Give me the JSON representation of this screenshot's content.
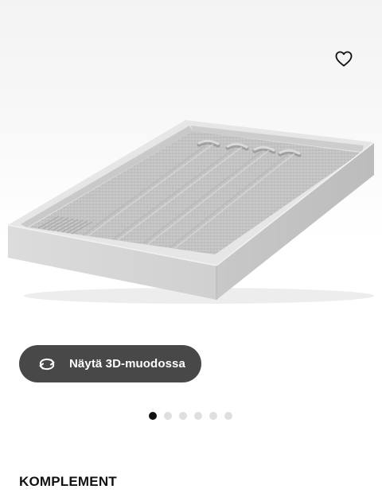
{
  "gallery": {
    "favorite_icon": "heart-outline-icon",
    "image_alt": "KOMPLEMENT",
    "view3d": {
      "label": "Näytä 3D-muodossa",
      "icon": "rotate-3d-icon"
    },
    "pagination": {
      "count": 6,
      "active_index": 0
    }
  },
  "product": {
    "name": "KOMPLEMENT"
  },
  "colors": {
    "button_bg": "#484848",
    "dot_active": "#111111",
    "dot_inactive": "#dfdfdf",
    "tray_frame": "#d9d9d9",
    "felt": "#c6c6c6"
  }
}
